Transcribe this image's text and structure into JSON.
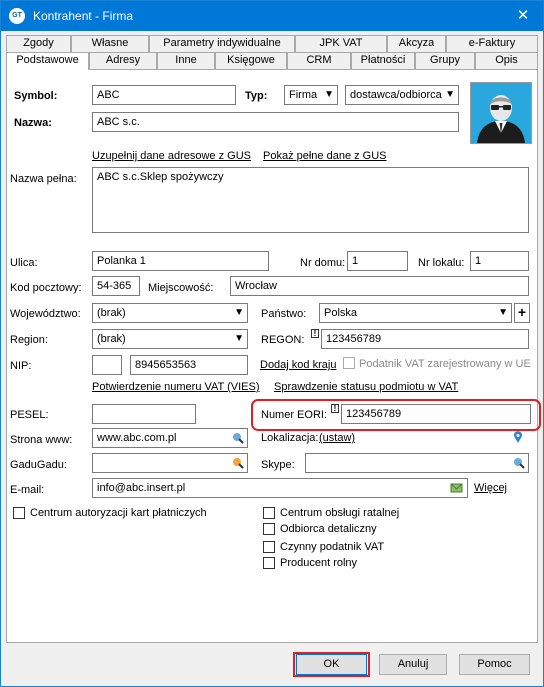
{
  "window": {
    "title": "Kontrahent - Firma",
    "icon": "insert-gt-logo-icon",
    "close_glyph": "✕"
  },
  "tabs_row1": [
    "Zgody",
    "Własne",
    "Parametry indywidualne",
    "JPK VAT",
    "Akcyza",
    "e-Faktury"
  ],
  "tabs_row2": [
    "Podstawowe",
    "Adresy",
    "Inne",
    "Księgowe",
    "CRM",
    "Płatności",
    "Grupy",
    "Opis"
  ],
  "active_tab": "Podstawowe",
  "form": {
    "symbol_label": "Symbol:",
    "symbol_value": "ABC",
    "typ_label": "Typ:",
    "typ_value": "Firma",
    "typ2_value": "dostawca/odbiorca",
    "nazwa_label": "Nazwa:",
    "nazwa_value": "ABC s.c.",
    "link_uzupelnij": "Uzupełnij dane adresowe z GUS",
    "link_pokaz": "Pokaż pełne dane z GUS",
    "nazwa_pelna_label": "Nazwa pełna:",
    "nazwa_pelna_value": "ABC s.c.Sklep spożywczy",
    "ulica_label": "Ulica:",
    "ulica_value": "Polanka 1",
    "nr_domu_label": "Nr domu:",
    "nr_domu_value": "1",
    "nr_lokalu_label": "Nr lokalu:",
    "nr_lokalu_value": "1",
    "kod_label": "Kod pocztowy:",
    "kod_value": "54-365",
    "miejscowosc_label": "Miejscowość:",
    "miejscowosc_value": "Wrocław",
    "wojewodztwo_label": "Województwo:",
    "wojewodztwo_value": "(brak)",
    "panstwo_label": "Państwo:",
    "panstwo_value": "Polska",
    "panstwo_add": "+",
    "region_label": "Region:",
    "region_value": "(brak)",
    "regon_label": "REGON:",
    "regon_value": "123456789",
    "nip_label": "NIP:",
    "nip_prefix": "",
    "nip_value": "8945653563",
    "link_dodaj_kod": "Dodaj kod kraju",
    "podatnik_vat_ue": "Podatnik VAT zarejestrowany w UE",
    "link_vies": "Potwierdzenie numeru VAT (VIES)",
    "link_status_vat": "Sprawdzenie statusu podmiotu w VAT",
    "pesel_label": "PESEL:",
    "pesel_value": "",
    "eori_label": "Numer EORI:",
    "eori_value": "123456789",
    "www_label": "Strona www:",
    "www_value": "www.abc.com.pl",
    "lokalizacja_label": "Lokalizacja:",
    "link_ustaw": "(ustaw)",
    "gadugadu_label": "GaduGadu:",
    "gadugadu_value": "",
    "skype_label": "Skype:",
    "skype_value": "",
    "email_label": "E-mail:",
    "email_value": "info@abc.insert.pl",
    "link_wiecej": "Więcej",
    "required_marker": "!"
  },
  "checkboxes": {
    "centrum_autoryzacji": "Centrum autoryzacji kart płatniczych",
    "centrum_obslugi": "Centrum obsługi ratalnej",
    "odbiorca_detaliczny": "Odbiorca detaliczny",
    "czynny_vat": "Czynny podatnik VAT",
    "producent_rolny": "Producent rolny"
  },
  "buttons": {
    "ok": "OK",
    "anuluj": "Anuluj",
    "pomoc": "Pomoc"
  },
  "colors": {
    "titlebar": "#0078d7",
    "highlight": "#e02020",
    "link_icon": "#4a90c8",
    "pin": "#2f86c9"
  }
}
